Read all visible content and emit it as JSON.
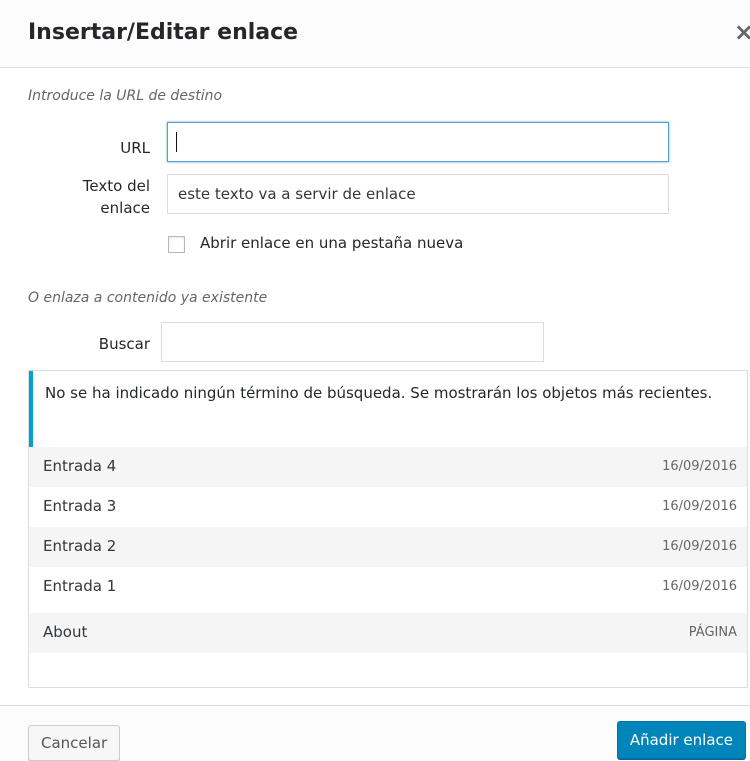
{
  "dialog": {
    "title": "Insertar/Editar enlace",
    "close_glyph": "×"
  },
  "url_section": {
    "help_text": "Introduce la URL de destino",
    "url_label": "URL",
    "url_value": "",
    "link_text_label_line1": "Texto del",
    "link_text_label_line2": "enlace",
    "link_text_value": "este texto va a servir de enlace",
    "new_tab_label": "Abrir enlace en una pestaña nueva",
    "new_tab_checked": false
  },
  "existing_section": {
    "help_text": "O enlaza a contenido ya existente",
    "search_label": "Buscar",
    "search_value": ""
  },
  "results": {
    "notice": "No se ha indicado ningún término de búsqueda. Se mostrarán los objetos más recientes.",
    "items": [
      {
        "title": "Entrada 4",
        "info": "16/09/2016"
      },
      {
        "title": "Entrada 3",
        "info": "16/09/2016"
      },
      {
        "title": "Entrada 2",
        "info": "16/09/2016"
      },
      {
        "title": "Entrada 1",
        "info": "16/09/2016"
      },
      {
        "title": "About",
        "info": "PÁGINA"
      }
    ]
  },
  "footer": {
    "cancel_label": "Cancelar",
    "add_label": "Añadir enlace"
  },
  "colors": {
    "accent": "#0085ba",
    "notice_border": "#00a0d2"
  }
}
